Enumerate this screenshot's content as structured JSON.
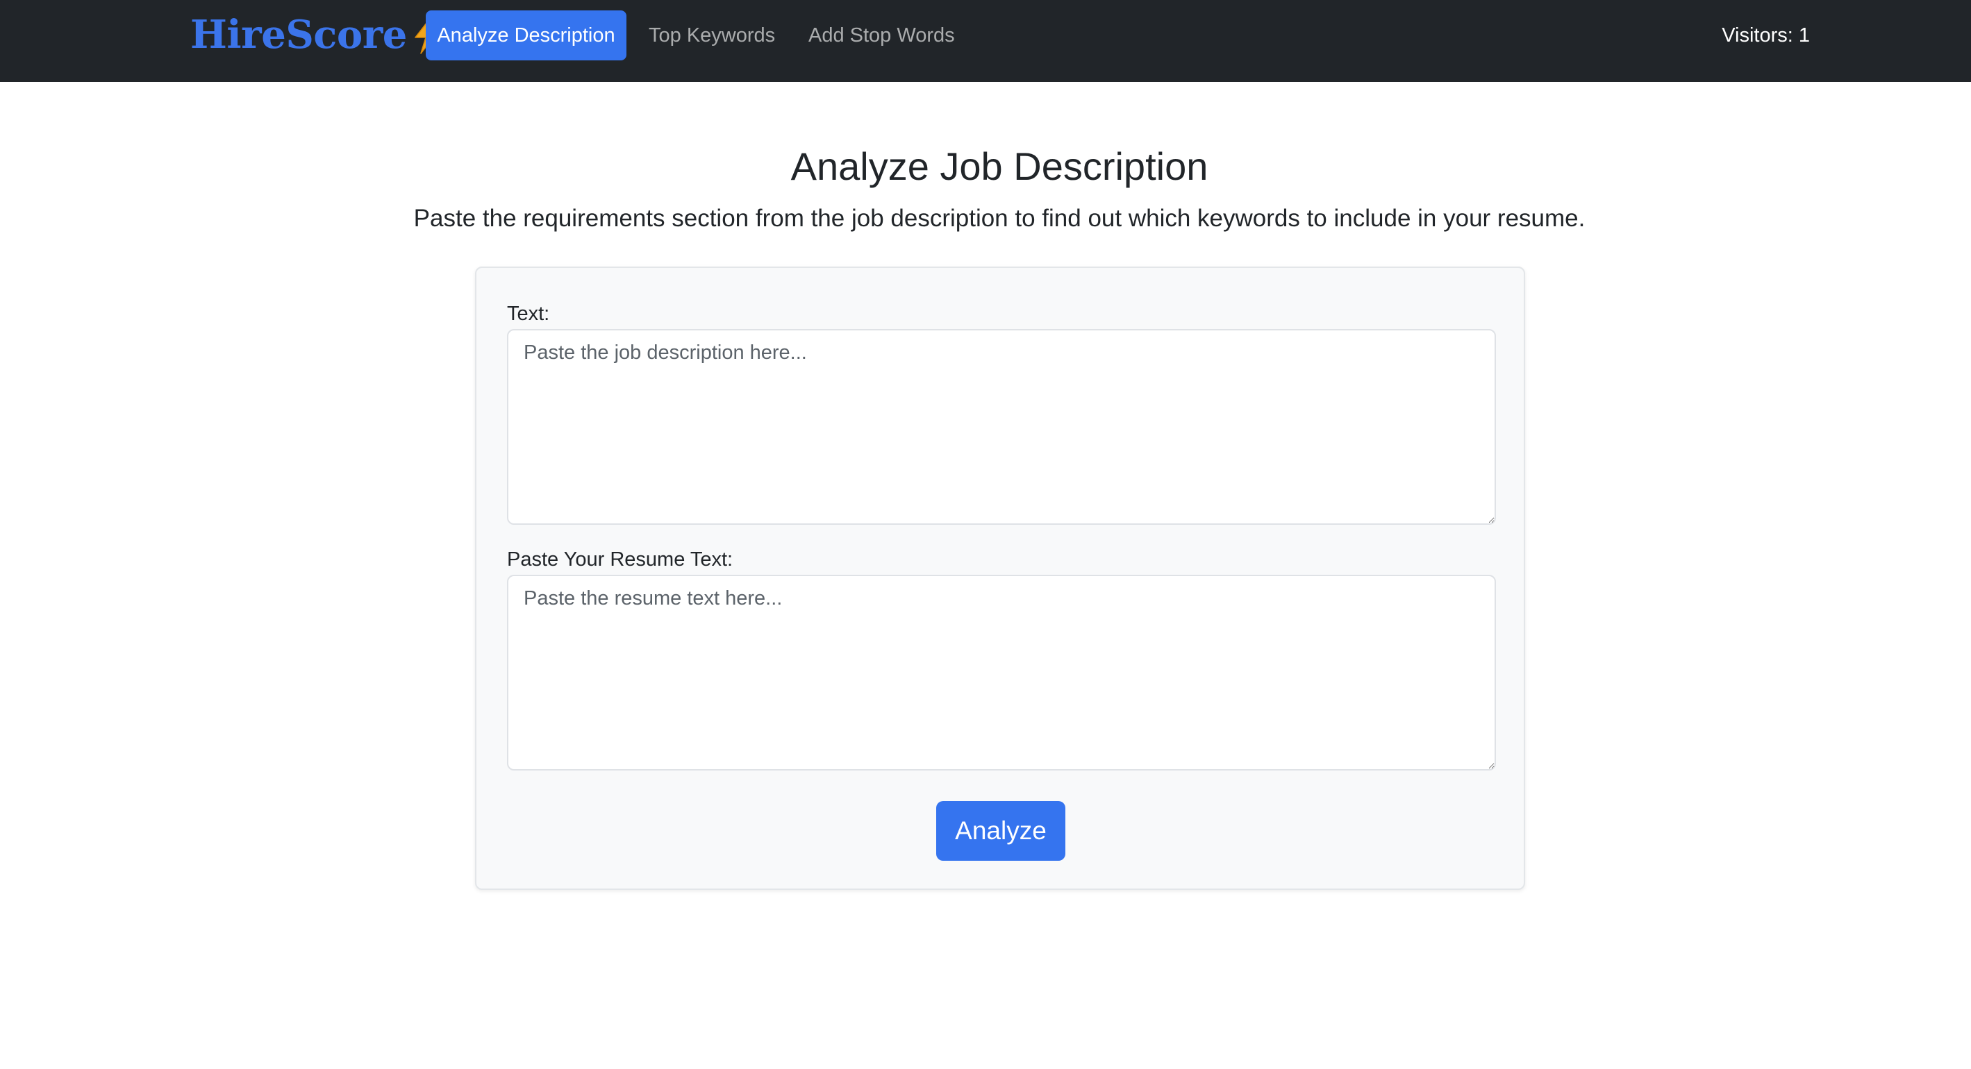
{
  "navbar": {
    "brand": "HireScore",
    "brand_icon": "lightning-bolt-icon",
    "items": [
      {
        "label": "Analyze Description",
        "active": true
      },
      {
        "label": "Top Keywords",
        "active": false
      },
      {
        "label": "Add Stop Words",
        "active": false
      }
    ],
    "visitors": "Visitors: 1"
  },
  "main": {
    "title": "Analyze Job Description",
    "subtitle": "Paste the requirements section from the job description to find out which keywords to include in your resume."
  },
  "form": {
    "job_label": "Text:",
    "job_placeholder": "Paste the job description here...",
    "job_value": "",
    "resume_label": "Paste Your Resume Text:",
    "resume_placeholder": "Paste the resume text here...",
    "resume_value": "",
    "submit_label": "Analyze"
  },
  "colors": {
    "navbar_bg": "#212529",
    "brand": "#3b74ea",
    "accent": "#3574ef",
    "card_bg": "#f8f9fa",
    "bolt": "#f0a020"
  }
}
